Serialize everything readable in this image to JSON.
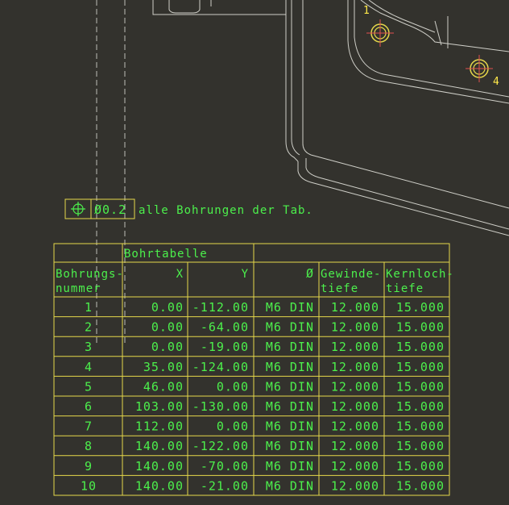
{
  "tolerance_frame": {
    "symbol": "position-icon",
    "value": "Ø0.2",
    "note": "alle Bohrungen der Tab."
  },
  "markers": [
    {
      "label": "1"
    },
    {
      "label": "4"
    }
  ],
  "table": {
    "title": "Bohrtabelle",
    "headers": {
      "number": [
        "Bohrungs-",
        "nummer"
      ],
      "x": "X",
      "y": "Y",
      "diameter": "Ø",
      "thread_depth": [
        "Gewinde-",
        "tiefe"
      ],
      "core_depth": [
        "Kernloch-",
        "tiefe"
      ]
    },
    "rows": [
      {
        "nr": "1",
        "x": "0.00",
        "y": "-112.00",
        "d": "M6 DIN",
        "g": "12.000",
        "k": "15.000"
      },
      {
        "nr": "2",
        "x": "0.00",
        "y": "-64.00",
        "d": "M6 DIN",
        "g": "12.000",
        "k": "15.000"
      },
      {
        "nr": "3",
        "x": "0.00",
        "y": "-19.00",
        "d": "M6 DIN",
        "g": "12.000",
        "k": "15.000"
      },
      {
        "nr": "4",
        "x": "35.00",
        "y": "-124.00",
        "d": "M6 DIN",
        "g": "12.000",
        "k": "15.000"
      },
      {
        "nr": "5",
        "x": "46.00",
        "y": "0.00",
        "d": "M6 DIN",
        "g": "12.000",
        "k": "15.000"
      },
      {
        "nr": "6",
        "x": "103.00",
        "y": "-130.00",
        "d": "M6 DIN",
        "g": "12.000",
        "k": "15.000"
      },
      {
        "nr": "7",
        "x": "112.00",
        "y": "0.00",
        "d": "M6 DIN",
        "g": "12.000",
        "k": "15.000"
      },
      {
        "nr": "8",
        "x": "140.00",
        "y": "-122.00",
        "d": "M6 DIN",
        "g": "12.000",
        "k": "15.000"
      },
      {
        "nr": "9",
        "x": "140.00",
        "y": "-70.00",
        "d": "M6 DIN",
        "g": "12.000",
        "k": "15.000"
      },
      {
        "nr": "10",
        "x": "140.00",
        "y": "-21.00",
        "d": "M6 DIN",
        "g": "12.000",
        "k": "15.000"
      }
    ]
  }
}
